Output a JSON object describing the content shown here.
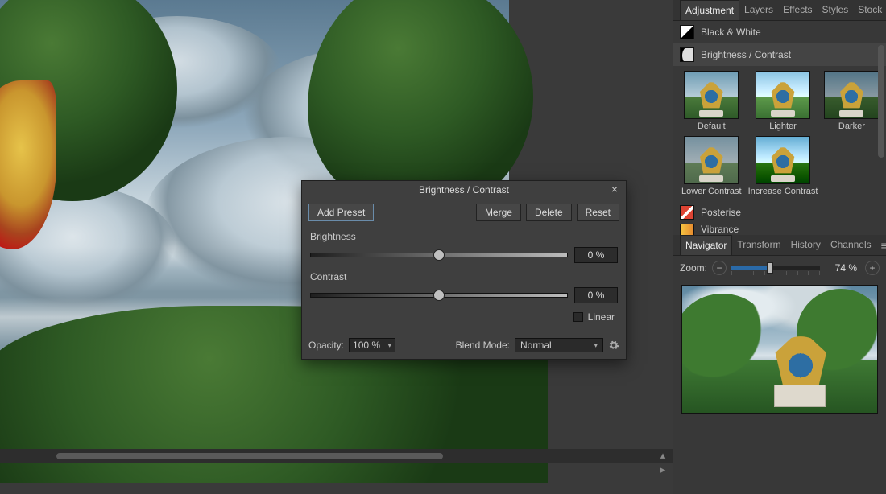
{
  "dialog": {
    "title": "Brightness / Contrast",
    "add_preset": "Add Preset",
    "merge": "Merge",
    "delete": "Delete",
    "reset": "Reset",
    "brightness_label": "Brightness",
    "brightness_value": "0 %",
    "contrast_label": "Contrast",
    "contrast_value": "0 %",
    "linear_label": "Linear",
    "opacity_label": "Opacity:",
    "opacity_value": "100 %",
    "blend_label": "Blend Mode:",
    "blend_value": "Normal"
  },
  "right": {
    "adjust_tabs": [
      "Adjustment",
      "Layers",
      "Effects",
      "Styles",
      "Stock"
    ],
    "adjust_active": 0,
    "bw_label": "Black & White",
    "bc_label": "Brightness / Contrast",
    "posterise_label": "Posterise",
    "vibrance_label": "Vibrance",
    "presets": [
      {
        "label": "Default",
        "variant": ""
      },
      {
        "label": "Lighter",
        "variant": "lighter"
      },
      {
        "label": "Darker",
        "variant": "darker"
      },
      {
        "label": "Lower Contrast",
        "variant": "low"
      },
      {
        "label": "Increase Contrast",
        "variant": "high"
      }
    ],
    "nav_tabs": [
      "Navigator",
      "Transform",
      "History",
      "Channels"
    ],
    "nav_active": 0,
    "zoom_label": "Zoom:",
    "zoom_value": "74 %"
  }
}
